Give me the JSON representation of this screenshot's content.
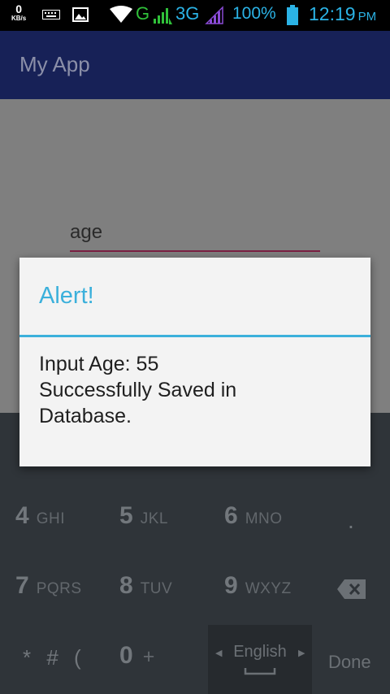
{
  "status_bar": {
    "net_speed_value": "0",
    "net_speed_unit": "KB/s",
    "network_g": "G",
    "network_3g": "3G",
    "battery_pct": "100%",
    "time": "12:19",
    "ampm": "PM",
    "colors": {
      "accent": "#2bb3e6",
      "g_green": "#30c13a"
    }
  },
  "app_bar": {
    "title": "My App",
    "color": "#172157"
  },
  "form": {
    "age_value": "age"
  },
  "dialog": {
    "title": "Alert!",
    "message_lines": [
      "Input Age: 55",
      "Successfully Saved in",
      "Database."
    ],
    "accent_color": "#3bb0db"
  },
  "keyboard": {
    "keys": [
      {
        "digit": "4",
        "letters": "GHI"
      },
      {
        "digit": "5",
        "letters": "JKL"
      },
      {
        "digit": "6",
        "letters": "MNO"
      },
      {
        "digit": "7",
        "letters": "PQRS"
      },
      {
        "digit": "8",
        "letters": "TUV"
      },
      {
        "digit": "9",
        "letters": "WXYZ"
      },
      {
        "digit": "0",
        "letters": "+"
      }
    ],
    "dot": ".",
    "symbols": "* # (",
    "language": "English",
    "done": "Done",
    "icons": [
      "backspace-icon",
      "space-bar-icon",
      "lang-prev-icon",
      "lang-next-icon"
    ]
  }
}
